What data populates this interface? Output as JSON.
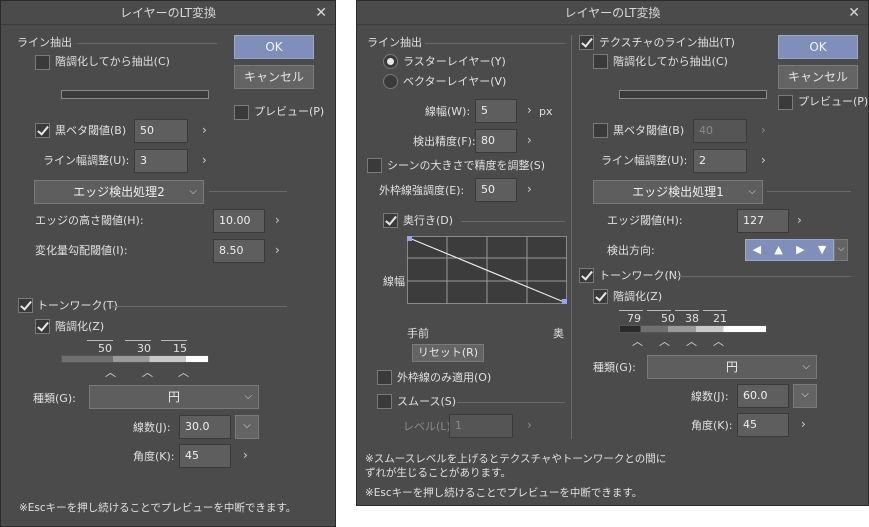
{
  "left": {
    "title": "レイヤーのLT変換",
    "close": "✕",
    "line_extract": "ライン抽出",
    "gradate_then_extract": "階調化してから抽出(C)",
    "ok": "OK",
    "cancel": "キャンセル",
    "preview": "プレビュー(P)",
    "black_threshold_label": "黒ベタ閾値(B)",
    "black_threshold_value": "50",
    "line_width_adjust_label": "ライン幅調整(U):",
    "line_width_adjust_value": "3",
    "edge_mode": "エッジ検出処理2",
    "edge_height_label": "エッジの高さ閾値(H):",
    "edge_height_value": "10.00",
    "gradient_label": "変化量勾配閾値(I):",
    "gradient_value": "8.50",
    "tonework": "トーンワーク(T)",
    "gradation": "階調化(Z)",
    "tone_levels": [
      "50",
      "30",
      "15"
    ],
    "kind_label": "種類(G):",
    "kind_value": "円",
    "lines_label": "線数(J):",
    "lines_value": "30.0",
    "angle_label": "角度(K):",
    "angle_value": "45",
    "note": "※Escキーを押し続けることでプレビューを中断できます。"
  },
  "right": {
    "title": "レイヤーのLT変換",
    "close": "✕",
    "line_extract": "ライン抽出",
    "raster": "ラスターレイヤー(Y)",
    "vector": "ベクターレイヤー(V)",
    "line_width_label": "線幅(W):",
    "line_width_value": "5",
    "line_width_unit": "px",
    "precision_label": "検出精度(F):",
    "precision_value": "80",
    "scale_precision": "シーンの大きさで精度を調整(S)",
    "outline_label": "外枠線強調度(E):",
    "outline_value": "50",
    "depth": "奥行き(D)",
    "graph_ylabel": "線幅",
    "graph_front": "手前",
    "graph_back": "奥",
    "reset": "リセット(R)",
    "outline_only": "外枠線のみ適用(O)",
    "smooth": "スムース(S)",
    "level_label": "レベル(L):",
    "level_value": "1",
    "texture_extract": "テクスチャのライン抽出(T)",
    "gradate_then_extract": "階調化してから抽出(C)",
    "ok": "OK",
    "cancel": "キャンセル",
    "preview": "プレビュー(P)",
    "black_threshold_label": "黒ベタ閾値(B)",
    "black_threshold_value": "40",
    "line_width_adjust_label": "ライン幅調整(U):",
    "line_width_adjust_value": "2",
    "edge_mode": "エッジ検出処理1",
    "edge_threshold_label": "エッジ閾値(H):",
    "edge_threshold_value": "127",
    "direction_label": "検出方向:",
    "tonework": "トーンワーク(N)",
    "gradation": "階調化(Z)",
    "tone_levels": [
      "79",
      "50",
      "38",
      "21"
    ],
    "kind_label": "種類(G):",
    "kind_value": "円",
    "lines_label": "線数(J):",
    "lines_value": "60.0",
    "angle_label": "角度(K):",
    "angle_value": "45",
    "note1": "※スムースレベルを上げるとテクスチャやトーンワークとの間に",
    "note2": "ずれが生じることがあります。",
    "note3": "※Escキーを押し続けることでプレビューを中断できます。"
  }
}
